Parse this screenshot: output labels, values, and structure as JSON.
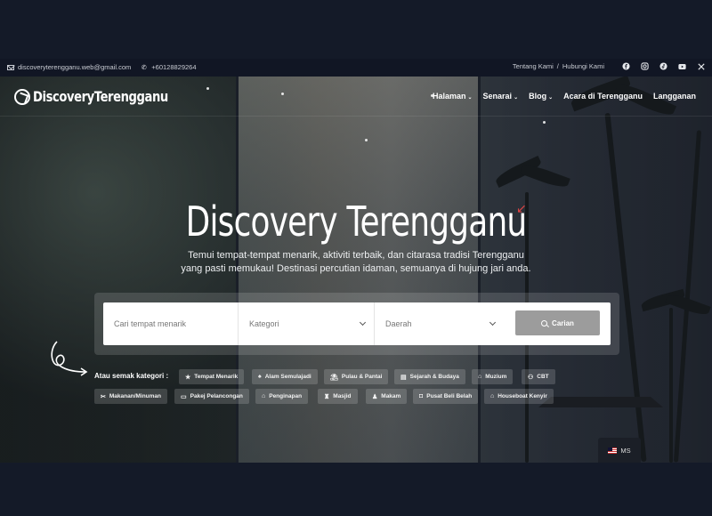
{
  "topbar": {
    "email": "discoveryterengganu.web@gmail.com",
    "phone": "+60128829264",
    "links": [
      "Tentang Kami",
      "/",
      "Hubungi Kami"
    ],
    "socials": [
      "facebook-icon",
      "instagram-icon",
      "tiktok-icon",
      "youtube-icon",
      "x-icon"
    ]
  },
  "nav": {
    "logo": "DiscoveryTerengganu",
    "items": [
      {
        "label": "Halaman",
        "dropdown": true
      },
      {
        "label": "Senarai",
        "dropdown": true
      },
      {
        "label": "Blog",
        "dropdown": true
      },
      {
        "label": "Acara di Terengganu",
        "dropdown": false
      },
      {
        "label": "Langganan",
        "dropdown": false
      }
    ]
  },
  "hero": {
    "title": "Discovery Terengganu",
    "subtitle_line1": "Temui tempat-tempat menarik, aktiviti terbaik, dan citarasa tradisi Terengganu",
    "subtitle_line2": "yang pasti memukau! Destinasi percutian idaman, semuanya di hujung jari anda."
  },
  "search": {
    "place_placeholder": "Cari tempat menarik",
    "category_label": "Kategori",
    "region_label": "Daerah",
    "button_label": "Carian"
  },
  "categories": {
    "label": "Atau semak kategori :",
    "row1": [
      {
        "label": "Tempat Menarik",
        "icon": "★"
      },
      {
        "label": "Alam Semulajadi",
        "icon": "♠"
      },
      {
        "label": "Pulau & Pantai",
        "icon": "⛱"
      },
      {
        "label": "Sejarah & Budaya",
        "icon": "▤"
      },
      {
        "label": "Muzium",
        "icon": "⌂"
      },
      {
        "label": "CBT",
        "icon": "⚇"
      }
    ],
    "row2": [
      {
        "label": "Makanan/Minuman",
        "icon": "✂"
      },
      {
        "label": "Pakej Pelancongan",
        "icon": "▭"
      },
      {
        "label": "Penginapan",
        "icon": "⌂"
      },
      {
        "label": "Masjid",
        "icon": "♜"
      },
      {
        "label": "Makam",
        "icon": "♟"
      },
      {
        "label": "Pusat Beli Belah",
        "icon": "◘"
      },
      {
        "label": "Houseboat Kenyir",
        "icon": "⌂"
      }
    ]
  },
  "language": {
    "code": "MS"
  }
}
